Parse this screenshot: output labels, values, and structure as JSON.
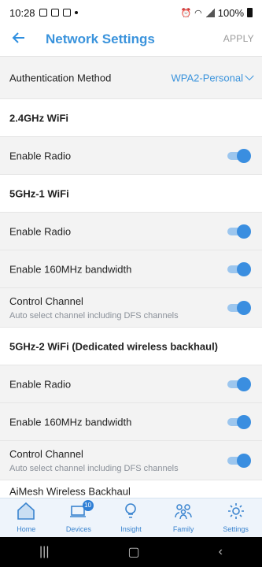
{
  "status": {
    "time": "10:28",
    "battery": "100%"
  },
  "header": {
    "title": "Network Settings",
    "apply": "APPLY",
    "back_icon": "arrow-left-icon"
  },
  "auth": {
    "label": "Authentication Method",
    "value": "WPA2-Personal"
  },
  "sections": {
    "s24": {
      "title": "2.4GHz WiFi",
      "enable_radio": "Enable Radio",
      "enable_radio_on": true
    },
    "s5_1": {
      "title": "5GHz-1 WiFi",
      "enable_radio": "Enable Radio",
      "enable_160": "Enable 160MHz bandwidth",
      "control_channel": "Control Channel",
      "control_sub": "Auto select channel including DFS channels"
    },
    "s5_2": {
      "title": "5GHz-2 WiFi (Dedicated wireless backhaul)",
      "enable_radio": "Enable Radio",
      "enable_160": "Enable 160MHz bandwidth",
      "control_channel": "Control Channel",
      "control_sub": "Auto select channel including DFS channels"
    },
    "aimesh": {
      "title": "AiMesh Wireless Backhaul"
    }
  },
  "nav": {
    "items": [
      {
        "label": "Home",
        "icon": "home-icon"
      },
      {
        "label": "Devices",
        "icon": "devices-icon",
        "badge": "10"
      },
      {
        "label": "Insight",
        "icon": "lightbulb-icon"
      },
      {
        "label": "Family",
        "icon": "family-icon"
      },
      {
        "label": "Settings",
        "icon": "gear-icon"
      }
    ]
  },
  "colors": {
    "accent": "#3a93dc",
    "toggle_knob": "#3a8ee0",
    "nav_bg": "#eef4fb"
  }
}
